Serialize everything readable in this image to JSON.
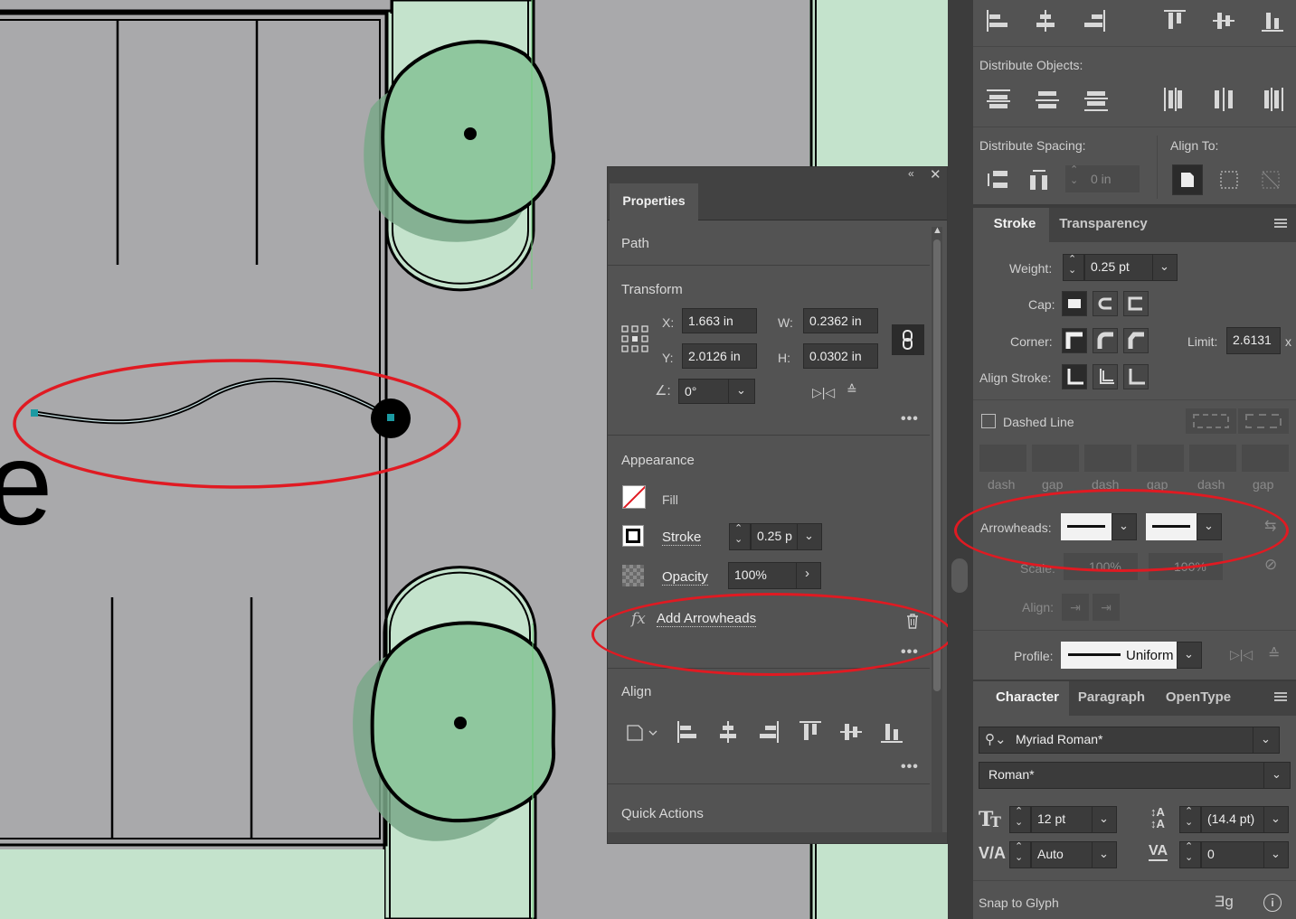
{
  "properties_panel": {
    "tab": "Properties",
    "selection_type": "Path",
    "transform": {
      "title": "Transform",
      "x_label": "X:",
      "x": "1.663 in",
      "y_label": "Y:",
      "y": "2.0126 in",
      "w_label": "W:",
      "w": "0.2362 in",
      "h_label": "H:",
      "h": "0.0302 in",
      "angle": "0°"
    },
    "appearance": {
      "title": "Appearance",
      "fill_label": "Fill",
      "stroke_label": "Stroke",
      "stroke_weight": "0.25 p",
      "opacity_label": "Opacity",
      "opacity": "100%",
      "effect_fx": "fx",
      "effect": "Add Arrowheads"
    },
    "align_title": "Align",
    "quick_actions_title": "Quick Actions"
  },
  "align_panel": {
    "distribute_objects": "Distribute Objects:",
    "distribute_spacing": "Distribute Spacing:",
    "spacing_value": "0 in",
    "align_to": "Align To:"
  },
  "stroke_panel": {
    "tabs": [
      "Stroke",
      "Transparency"
    ],
    "weight_label": "Weight:",
    "weight": "0.25 pt",
    "cap_label": "Cap:",
    "corner_label": "Corner:",
    "limit_label": "Limit:",
    "limit": "2.6131",
    "limit_suffix": "x",
    "align_stroke_label": "Align Stroke:",
    "dashed_line_label": "Dashed Line",
    "dash_labels": [
      "dash",
      "gap",
      "dash",
      "gap",
      "dash",
      "gap"
    ],
    "arrowheads_label": "Arrowheads:",
    "scale_label": "Scale:",
    "scale_start": "100%",
    "scale_end": "100%",
    "align_label": "Align:",
    "profile_label": "Profile:",
    "profile": "Uniform"
  },
  "character_panel": {
    "tabs": [
      "Character",
      "Paragraph",
      "OpenType"
    ],
    "font_family": "Myriad Roman*",
    "font_style": "Roman*",
    "font_size": "12 pt",
    "leading": "(14.4 pt)",
    "kerning": "Auto",
    "tracking": "0",
    "snap_to_glyph": "Snap to Glyph"
  },
  "canvas": {
    "partial_letter": "e"
  },
  "colors": {
    "canvas_gray": "#a9a9ab",
    "plant_green": "#8fc79e",
    "pad_green": "#c4e3cc",
    "annotation_red": "#e01a22",
    "panel_bg": "#535353"
  }
}
